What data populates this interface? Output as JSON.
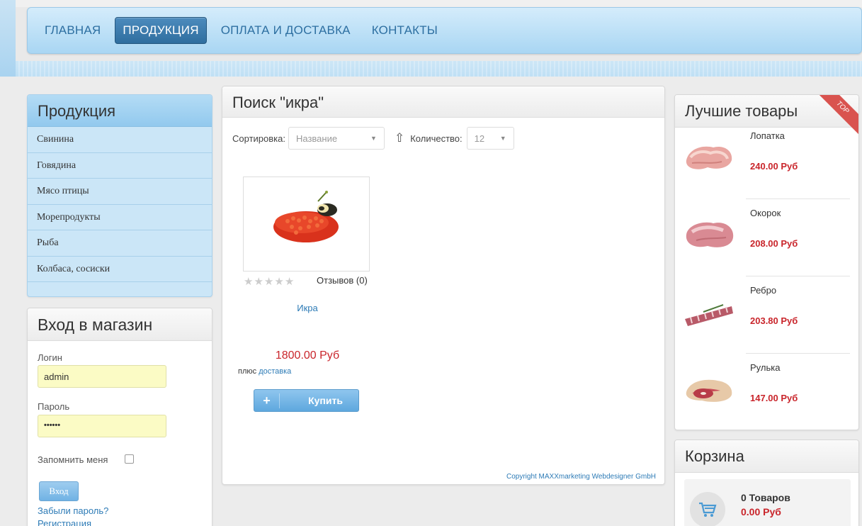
{
  "nav": {
    "items": [
      "ГЛАВНАЯ",
      "ПРОДУКЦИЯ",
      "ОПЛАТА И ДОСТАВКА",
      "КОНТАКТЫ"
    ],
    "active": "ПРОДУКЦИЯ"
  },
  "categories": {
    "title": "Продукция",
    "items": [
      "Свинина",
      "Говядина",
      "Мясо птицы",
      "Морепродукты",
      "Рыба",
      "Колбаса, сосиски"
    ]
  },
  "login": {
    "title": "Вход в магазин",
    "username_label": "Логин",
    "username_value": "admin",
    "password_label": "Пароль",
    "password_value": "••••••",
    "remember_label": "Запомнить меня",
    "submit_label": "Вход",
    "forgot_label": "Забыли пароль?",
    "register_label": "Регистрация"
  },
  "search": {
    "title": "Поиск \"икра\"",
    "sort_label": "Сортировка:",
    "sort_value": "Название",
    "count_label": "Количество:",
    "count_value": "12",
    "sort_direction_icon": "arrow-up-outline-icon"
  },
  "product": {
    "name": "Икра",
    "reviews": "Отзывов (0)",
    "rating": 0,
    "rating_max": 5,
    "price": "1800.00 Руб",
    "shipping_prefix": "плюс ",
    "shipping_link": "доставка",
    "buy_label": "Купить",
    "buy_icon": "+"
  },
  "footer": {
    "copyright": "Copyright MAXXmarketing Webdesigner GmbH"
  },
  "best": {
    "title": "Лучшие товары",
    "ribbon": "TOP",
    "items": [
      {
        "name": "Лопатка",
        "price": "240.00 Руб"
      },
      {
        "name": "Окорок",
        "price": "208.00 Руб"
      },
      {
        "name": "Ребро",
        "price": "203.80 Руб"
      },
      {
        "name": "Рулька",
        "price": "147.00 Руб"
      }
    ]
  },
  "cart": {
    "title": "Корзина",
    "count": "0 Товаров",
    "total": "0.00 Руб"
  },
  "colors": {
    "accent": "#2d7bb6",
    "price": "#c9252b",
    "nav_bg": "#a9d6f3",
    "nav_active": "#2f6e9f"
  }
}
